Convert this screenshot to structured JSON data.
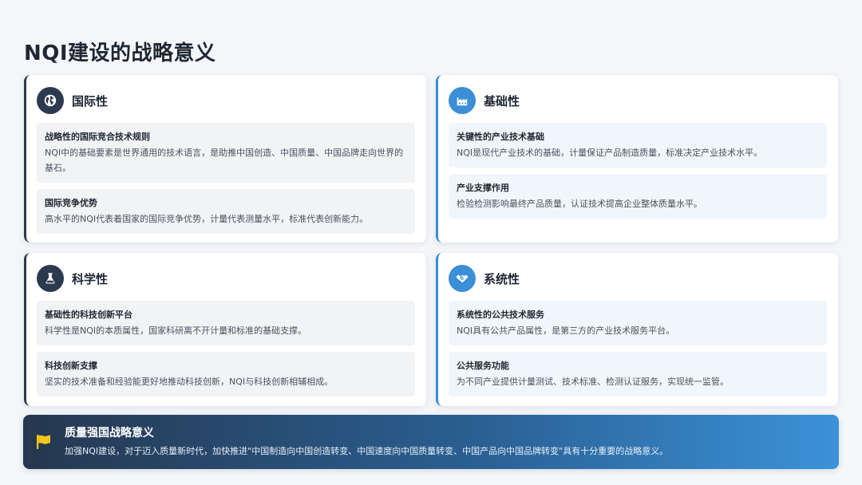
{
  "page": {
    "title": "NQI建设的战略意义"
  },
  "cards": [
    {
      "title": "国际性",
      "icon": "globe-icon",
      "blocks": [
        {
          "title": "战略性的国际竞合技术规则",
          "text": "NQI中的基础要素是世界通用的技术语言，是助推中国创造、中国质量、中国品牌走向世界的基石。"
        },
        {
          "title": "国际竞争优势",
          "text": "高水平的NQI代表着国家的国际竞争优势，计量代表测量水平，标准代表创新能力。"
        }
      ]
    },
    {
      "title": "基础性",
      "icon": "factory-icon",
      "blocks": [
        {
          "title": "关键性的产业技术基础",
          "text": "NQI是现代产业技术的基础，计量保证产品制造质量，标准决定产业技术水平。"
        },
        {
          "title": "产业支撑作用",
          "text": "检验检测影响最终产品质量，认证技术提高企业整体质量水平。"
        }
      ]
    },
    {
      "title": "科学性",
      "icon": "flask-icon",
      "blocks": [
        {
          "title": "基础性的科技创新平台",
          "text": "科学性是NQI的本质属性，国家科研离不开计量和标准的基础支撑。"
        },
        {
          "title": "科技创新支撑",
          "text": "坚实的技术准备和经验能更好地推动科技创新，NQI与科技创新相辅相成。"
        }
      ]
    },
    {
      "title": "系统性",
      "icon": "handshake-icon",
      "blocks": [
        {
          "title": "系统性的公共技术服务",
          "text": "NQI具有公共产品属性，是第三方的产业技术服务平台。"
        },
        {
          "title": "公共服务功能",
          "text": "为不同产业提供计量测试、技术标准、检测认证服务，实现统一监管。"
        }
      ]
    }
  ],
  "banner": {
    "title": "质量强国战略意义",
    "text": "加强NQI建设，对于迈入质量新时代，加快推进\"中国制造向中国创造转变、中国速度向中国质量转变、中国产品向中国品牌转变\"具有十分重要的战略意义。",
    "icon": "flag-icon"
  },
  "colors": {
    "dark_accent": "#2c3a4f",
    "blue_accent": "#3a8fd6",
    "flag": "#f5c518"
  }
}
